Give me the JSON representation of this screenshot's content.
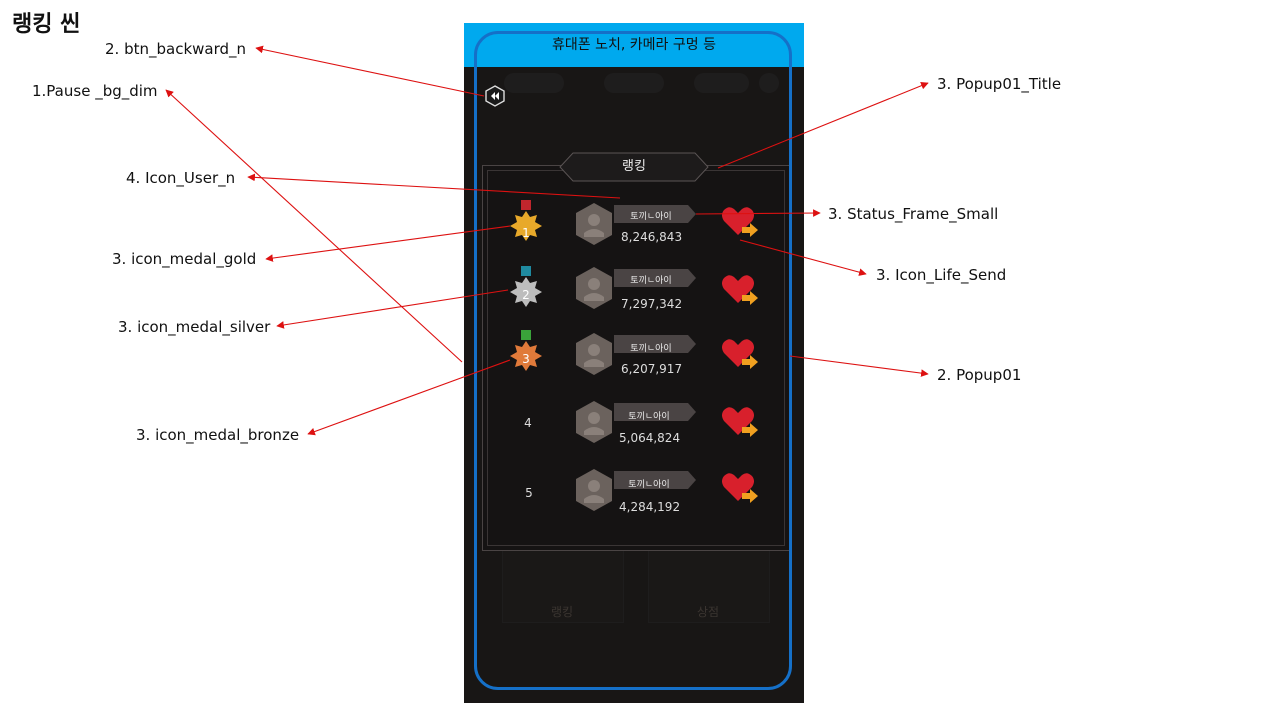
{
  "page_title": "랭킹 씬",
  "phone": {
    "notch_label": "휴대폰 노치, 카메라 구멍 등",
    "popup_title": "랭킹",
    "rows": [
      {
        "rank": "1",
        "medal": "gold",
        "name": "토끼ㄴ아이",
        "score": "8,246,843"
      },
      {
        "rank": "2",
        "medal": "silver",
        "name": "토끼ㄴ아이",
        "score": "7,297,342"
      },
      {
        "rank": "3",
        "medal": "bronze",
        "name": "토끼ㄴ아이",
        "score": "6,207,917"
      },
      {
        "rank": "4",
        "medal": "",
        "name": "토끼ㄴ아이",
        "score": "5,064,824"
      },
      {
        "rank": "5",
        "medal": "",
        "name": "토끼ㄴ아이",
        "score": "4,284,192"
      }
    ],
    "bottom_buttons": [
      "랭킹",
      "상점"
    ]
  },
  "annotations": {
    "btn_backward": "2. btn_backward_n",
    "pause_bg": "1.Pause _bg_dim",
    "icon_user": "4. Icon_User_n",
    "medal_gold": "3. icon_medal_gold",
    "medal_silver": "3. icon_medal_silver",
    "medal_bronze": "3. icon_medal_bronze",
    "popup_title": "3. Popup01_Title",
    "status_frame": "3. Status_Frame_Small",
    "icon_life_send": "3. Icon_Life_Send",
    "popup01": "2. Popup01"
  },
  "colors": {
    "notch": "#00a9ee",
    "safe_area": "#1570c8",
    "annotation_arrow": "#dd1111",
    "medal_gold": "#e8a92a",
    "medal_silver": "#bdbdbd",
    "medal_bronze": "#e07a3a",
    "heart": "#d8202c",
    "arrow_orange": "#f0a020"
  }
}
